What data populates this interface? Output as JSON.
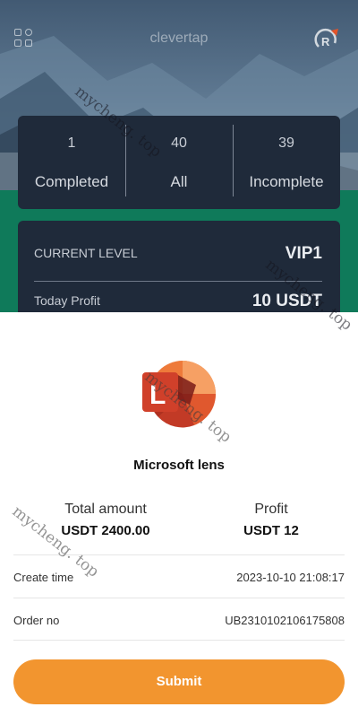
{
  "header": {
    "brand": "clevertap",
    "apps_icon": "grid-apps-icon",
    "refresh_icon": "refresh-icon"
  },
  "stats": [
    {
      "value": "1",
      "label": "Completed"
    },
    {
      "value": "40",
      "label": "All"
    },
    {
      "value": "39",
      "label": "Incomplete"
    }
  ],
  "level": {
    "current_level_label": "CURRENT LEVEL",
    "current_level_value": "VIP1",
    "today_profit_label": "Today Profit",
    "today_profit_value": "10 USDT"
  },
  "order": {
    "app_name": "Microsoft lens",
    "total_amount_label": "Total amount",
    "total_amount_value": "USDT 2400.00",
    "profit_label": "Profit",
    "profit_value": "USDT 12",
    "create_time_label": "Create time",
    "create_time_value": "2023-10-10 21:08:17",
    "order_no_label": "Order no",
    "order_no_value": "UB2310102106175808",
    "submit_label": "Submit"
  },
  "watermark": "mycheng. top",
  "colors": {
    "accent": "#f2952f",
    "card_bg": "#1f2a3a",
    "green_band": "#0f7a5a",
    "logo_red": "#d0402a",
    "logo_orange": "#ee7a3a"
  }
}
